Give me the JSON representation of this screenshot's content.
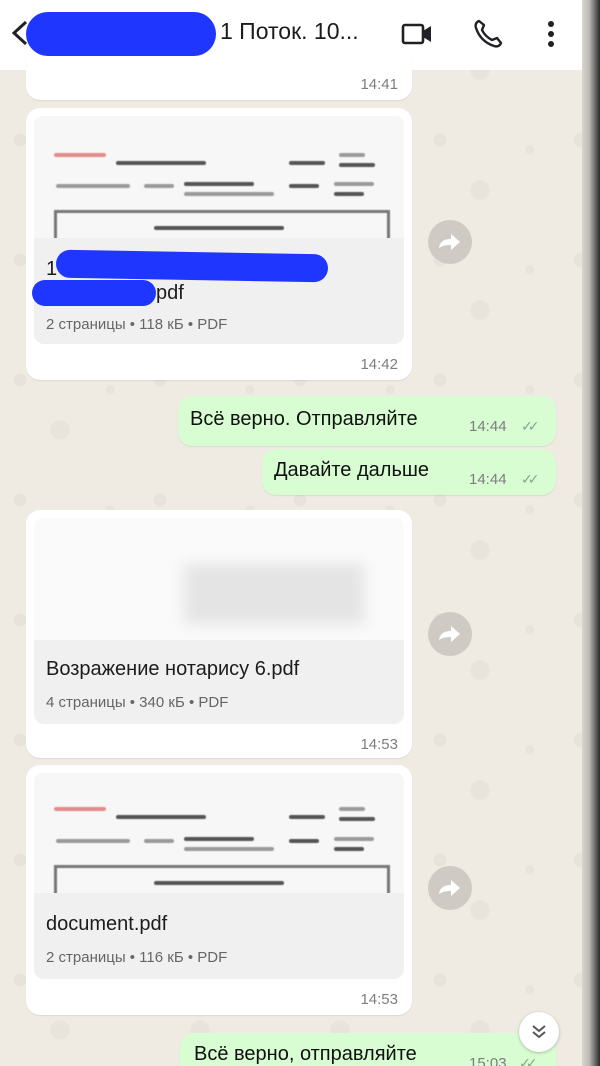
{
  "header": {
    "title": "1 Поток. 10...",
    "icons": [
      "back-arrow-icon",
      "video-call-icon",
      "voice-call-icon",
      "more-vert-icon"
    ]
  },
  "messages": [
    {
      "type": "time-only",
      "time": "14:41"
    },
    {
      "type": "document",
      "name_visible": "pdf",
      "name_prefix_visible": "1",
      "meta": "2 страницы • 118 кБ • PDF",
      "time": "14:42"
    },
    {
      "type": "text-out",
      "text": "Всё верно. Отправляйте",
      "time": "14:44"
    },
    {
      "type": "text-out",
      "text": "Давайте дальше",
      "time": "14:44"
    },
    {
      "type": "document",
      "name": "Возражение нотарису 6.pdf",
      "meta": "4 страницы • 340 кБ • PDF",
      "time": "14:53"
    },
    {
      "type": "document",
      "name": "document.pdf",
      "meta": "2 страницы • 116 кБ • PDF",
      "time": "14:53"
    },
    {
      "type": "text-out",
      "text": "Всё верно, отправляйте",
      "time": "15:03"
    }
  ],
  "ticks_glyph": "✓✓",
  "scroll_down_glyph": "»",
  "colors": {
    "outgoing_bubble": "#d9fdd3",
    "incoming_bubble": "#ffffff",
    "chat_background": "#efeae2",
    "redaction": "#1f36ff"
  }
}
